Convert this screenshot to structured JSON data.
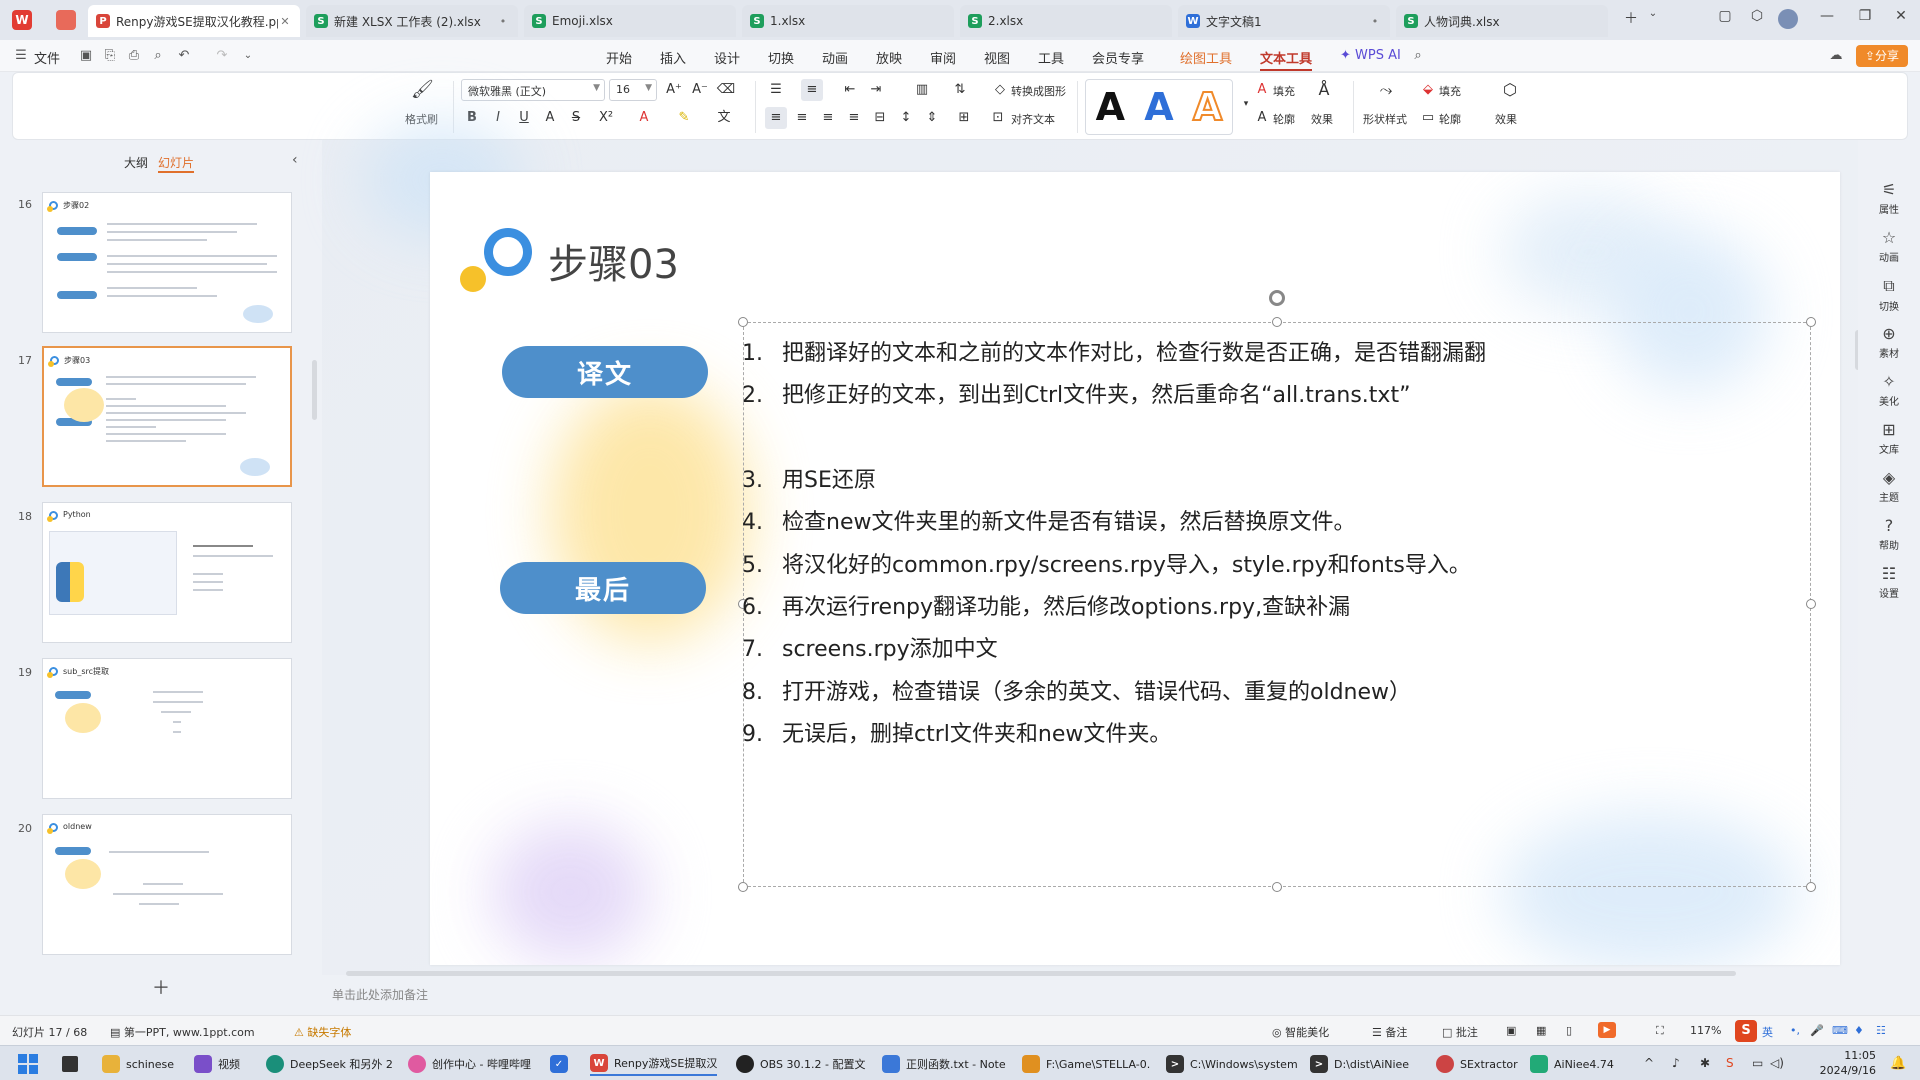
{
  "tabs": [
    {
      "label": "Renpy游戏SE提取汉化教程.pp",
      "icon": "P",
      "color": "#d9453a",
      "active": true,
      "closable": true
    },
    {
      "label": "新建 XLSX 工作表 (2).xlsx",
      "icon": "S",
      "color": "#1e9e5c",
      "closable": true
    },
    {
      "label": "Emoji.xlsx",
      "icon": "S",
      "color": "#1e9e5c"
    },
    {
      "label": "1.xlsx",
      "icon": "S",
      "color": "#1e9e5c"
    },
    {
      "label": "2.xlsx",
      "icon": "S",
      "color": "#1e9e5c"
    },
    {
      "label": "文字文稿1",
      "icon": "W",
      "color": "#2f6fd8",
      "closable": true
    },
    {
      "label": "人物词典.xlsx",
      "icon": "S",
      "color": "#1e9e5c"
    }
  ],
  "menu": {
    "file": "文件",
    "items": [
      "开始",
      "插入",
      "设计",
      "切换",
      "动画",
      "放映",
      "审阅",
      "视图",
      "工具",
      "会员专享"
    ],
    "draw_tools": "绘图工具",
    "text_tools": "文本工具",
    "wps_ai": "WPS AI",
    "share": "分享"
  },
  "ribbon": {
    "format_painter": "格式刷",
    "font_name": "微软雅黑 (正文)",
    "font_size": "16",
    "to_shape": "转换成图形",
    "align_text": "对齐文本",
    "fill": "填充",
    "outline": "轮廓",
    "effects": "效果",
    "shape_style": "形状样式",
    "shape_fill": "填充",
    "shape_outline": "轮廓",
    "shape_effects": "效果",
    "text_style_samples": [
      "A",
      "A",
      "A"
    ]
  },
  "left_panel": {
    "tab_outline": "大纲",
    "tab_slides": "幻灯片",
    "slides": [
      {
        "num": "16",
        "title": "步骤02"
      },
      {
        "num": "17",
        "title": "步骤03",
        "selected": true
      },
      {
        "num": "18",
        "title": "Python"
      },
      {
        "num": "19",
        "title": "sub_src提取"
      },
      {
        "num": "20",
        "title": "oldnew"
      }
    ]
  },
  "slide": {
    "title": "步骤03",
    "pill_translation": "译文",
    "pill_final": "最后",
    "steps": [
      {
        "n": "1.",
        "text": "把翻译好的文本和之前的文本作对比，检查行数是否正确，是否错翻漏翻"
      },
      {
        "n": "2.",
        "text": "把修正好的文本，到出到Ctrl文件夹，然后重命名“all.trans.txt”"
      },
      {
        "n": "3.",
        "text": "用SE还原"
      },
      {
        "n": "4.",
        "text": "检查new文件夹里的新文件是否有错误，然后替换原文件。"
      },
      {
        "n": "5.",
        "text": "将汉化好的common.rpy/screens.rpy导入，style.rpy和fonts导入。"
      },
      {
        "n": "6.",
        "text": "再次运行renpy翻译功能，然后修改options.rpy,查缺补漏"
      },
      {
        "n": "7.",
        "text": "screens.rpy添加中文"
      },
      {
        "n": "8.",
        "text": "打开游戏，检查错误（多余的英文、错误代码、重复的oldnew）"
      },
      {
        "n": "9.",
        "text": "无误后，删掉ctrl文件夹和new文件夹。"
      }
    ]
  },
  "notes_placeholder": "单击此处添加备注",
  "right_sidebar": [
    "属性",
    "动画",
    "切换",
    "素材",
    "美化",
    "文库",
    "主题",
    "帮助",
    "设置"
  ],
  "status": {
    "slide_pos": "幻灯片 17 / 68",
    "theme": "第一PPT, www.1ppt.com",
    "missing_font": "缺失字体",
    "smart_beautify": "智能美化",
    "notes": "备注",
    "comments": "批注",
    "zoom": "117%"
  },
  "taskbar": [
    {
      "label": "schinese",
      "color": "#e8b23a"
    },
    {
      "label": "视频",
      "color": "#7a4fc9"
    },
    {
      "label": "DeepSeek 和另外 2",
      "color": "#1a8f7a"
    },
    {
      "label": "创作中心 - 哔哩哔哩",
      "color": "#e05aa0"
    },
    {
      "label": "",
      "color": "#2f6fd8"
    },
    {
      "label": "Renpy游戏SE提取汉",
      "color": "#d9453a",
      "active": true
    },
    {
      "label": "OBS 30.1.2 - 配置文",
      "color": "#222"
    },
    {
      "label": "正则函数.txt - Note",
      "color": "#3b78d8"
    },
    {
      "label": "F:\\Game\\STELLA-0.",
      "color": "#e09020"
    },
    {
      "label": "C:\\Windows\\system",
      "color": "#333"
    },
    {
      "label": "D:\\dist\\AiNiee",
      "color": "#333"
    },
    {
      "label": "SExtractor",
      "color": "#c44"
    },
    {
      "label": "AiNiee4.74",
      "color": "#2a7"
    }
  ],
  "clock": {
    "time": "11:05",
    "date": "2024/9/16"
  },
  "input_method": "英"
}
